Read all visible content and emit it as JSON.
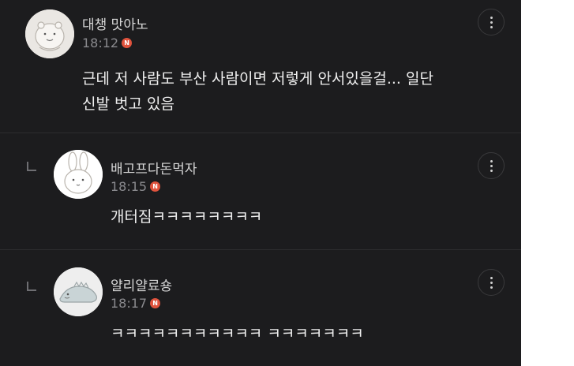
{
  "comments": [
    {
      "nickname": "대챙 맛아노",
      "time": "18:12",
      "badge": "N",
      "lines": [
        "근데 저 사람도 부산 사람이면 저렇게 안서있을걸... 일단",
        "신발 벗고 있음"
      ],
      "is_reply": false
    },
    {
      "nickname": "배고프다돈먹자",
      "time": "18:15",
      "badge": "N",
      "lines": [
        "개터짐ㅋㅋㅋㅋㅋㅋㅋㅋ"
      ],
      "is_reply": true
    },
    {
      "nickname": "얄리얄료숑",
      "time": "18:17",
      "badge": "N",
      "lines": [
        "ㅋㅋㅋㅋㅋㅋㅋㅋㅋㅋㅋ ㅋㅋㅋㅋㅋㅋㅋ"
      ],
      "is_reply": true
    }
  ],
  "icons": {
    "more": "more-vertical-icon",
    "reply": "reply-arrow-icon",
    "badge": "new-badge-icon"
  },
  "colors": {
    "background": "#1c1c1e",
    "badge": "#e0533d",
    "text": "#efefef",
    "meta": "#8a8a8e"
  }
}
